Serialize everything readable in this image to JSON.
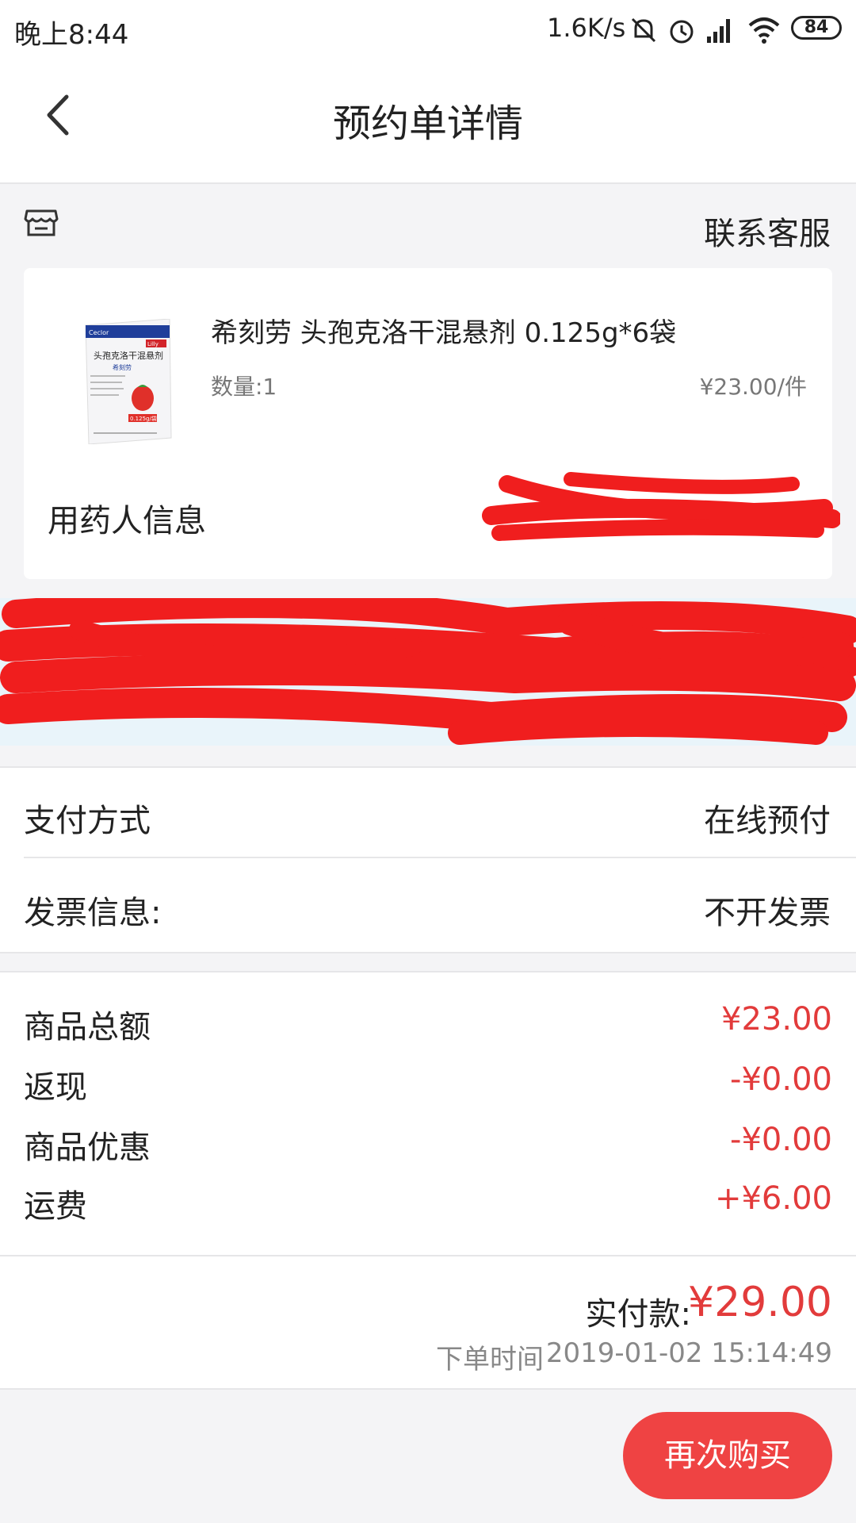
{
  "status_bar": {
    "time": "晚上8:44",
    "net_speed": "1.6K/s",
    "battery": "84"
  },
  "nav": {
    "title": "预约单详情"
  },
  "shop": {
    "contact_label": "联系客服"
  },
  "product": {
    "name": "希刻劳 头孢克洛干混悬剂 0.125g*6袋",
    "quantity": "数量:1",
    "unit_price": "¥23.00/件",
    "patient_label": "用药人信息",
    "image_text": {
      "brand_top": "Ceclor",
      "title": "头孢克洛干混悬剂",
      "name_cn": "希刻劳",
      "dose": "0.125g/袋",
      "maker": "Lilly"
    }
  },
  "payment": {
    "method_label": "支付方式",
    "method_value": "在线预付",
    "invoice_label": "发票信息:",
    "invoice_value": "不开发票"
  },
  "totals": {
    "rows": [
      {
        "label": "商品总额",
        "value": "¥23.00"
      },
      {
        "label": "返现",
        "value": "-¥0.00"
      },
      {
        "label": "商品优惠",
        "value": "-¥0.00"
      },
      {
        "label": "运费",
        "value": "+¥6.00"
      }
    ],
    "paid_label": "实付款:",
    "paid_value": "¥29.00",
    "order_time_label": "下单时间",
    "order_time_value": "2019-01-02 15:14:49"
  },
  "actions": {
    "buy_again": "再次购买"
  },
  "colors": {
    "accent_red": "#e23b3b",
    "button_red": "#ef4343",
    "redaction_red": "#f01e1e"
  }
}
